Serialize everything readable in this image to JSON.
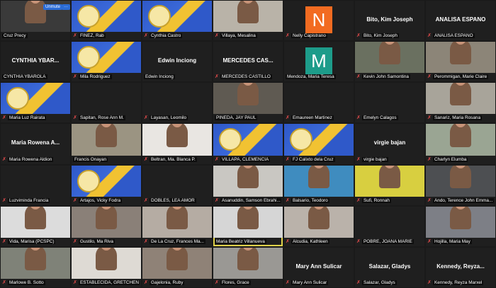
{
  "meeting": {
    "unmute_label": "Unmute",
    "more_label": "···"
  },
  "tiles": [
    {
      "name": "Cruz Precy",
      "type": "video",
      "muted": false,
      "bg": "#3a3a3a"
    },
    {
      "name": "FINEZ, Rab",
      "type": "logo",
      "muted": true
    },
    {
      "name": "Cynthia Castro",
      "type": "logo",
      "muted": true
    },
    {
      "name": "Villaya, Mesalina",
      "type": "video",
      "muted": true,
      "bg": "#b9b3a8"
    },
    {
      "name": "Nelly Capistrano",
      "type": "avatar",
      "letter": "N",
      "color": "#f26b21",
      "muted": true
    },
    {
      "name": "Bito, Kim Joseph",
      "type": "name",
      "title": "Bito, Kim Joseph",
      "muted": true
    },
    {
      "name": "ANALISA ESPANO",
      "type": "name",
      "title": "ANALISA ESPANO",
      "muted": true
    },
    {
      "name": "CYNTHIA YBAROLA",
      "type": "name",
      "title": "CYNTHIA YBAR...",
      "muted": false
    },
    {
      "name": "Mila Rodriguez",
      "type": "logo",
      "muted": true
    },
    {
      "name": "Edwin Inciong",
      "type": "name",
      "title": "Edwin Inciong",
      "muted": false
    },
    {
      "name": "MERCEDES CASTILLO",
      "type": "name",
      "title": "MERCEDES  CAS...",
      "muted": true
    },
    {
      "name": "Mendoza, Maria Teresa",
      "type": "avatar",
      "letter": "M",
      "color": "#1d9c8a",
      "muted": false
    },
    {
      "name": "Kevin John Samontina",
      "type": "video",
      "muted": true,
      "bg": "#6a7060"
    },
    {
      "name": "Perommigan, Marie Claire",
      "type": "video",
      "muted": true,
      "bg": "#8c8578"
    },
    {
      "name": "Maria Luz Rairata",
      "type": "logo",
      "muted": true
    },
    {
      "name": "Sapitan, Rose Ann M.",
      "type": "blank",
      "muted": true
    },
    {
      "name": "Layasan, Leomilo",
      "type": "blank",
      "muted": true
    },
    {
      "name": "PINEDA, JAY PAUL",
      "type": "video",
      "muted": false,
      "bg": "#5f5a52"
    },
    {
      "name": "Emaureen Martinez",
      "type": "blank",
      "muted": true
    },
    {
      "name": "Emelyn Calagos",
      "type": "blank",
      "muted": true
    },
    {
      "name": "Sanariz, Maria Rosana",
      "type": "video",
      "muted": true,
      "bg": "#a8a49a"
    },
    {
      "name": "Maria Rowena Aldion",
      "type": "name",
      "title": "Maria Rowena A...",
      "muted": true
    },
    {
      "name": "Francis Onayan",
      "type": "video",
      "muted": false,
      "bg": "#9b9482"
    },
    {
      "name": "Beltran, Ma. Blanca P.",
      "type": "video",
      "muted": true,
      "bg": "#e9e6e2"
    },
    {
      "name": "VILLAPA, CLEMENCIA",
      "type": "logo",
      "muted": true
    },
    {
      "name": "FJ Calixto dela Cruz",
      "type": "logo",
      "muted": true
    },
    {
      "name": "virgie bajan",
      "type": "name",
      "title": "virgie bajan",
      "muted": true
    },
    {
      "name": "Charlyn Elumba",
      "type": "video",
      "muted": true,
      "bg": "#9aa593"
    },
    {
      "name": "Luzviminda Francia",
      "type": "blank",
      "muted": true
    },
    {
      "name": "Artajos, Vicky Fodra",
      "type": "logo",
      "muted": true
    },
    {
      "name": "DOBLES, LEA AMOR",
      "type": "blank",
      "muted": true
    },
    {
      "name": "Asanuddin, Samson Ebrahi...",
      "type": "video",
      "muted": true,
      "bg": "#c9c7c2"
    },
    {
      "name": "Balsario, Teodoro",
      "type": "video",
      "muted": true,
      "bg": "#3f8cbf"
    },
    {
      "name": "Sufi, Ronnah",
      "type": "video",
      "muted": true,
      "bg": "#d8cf40"
    },
    {
      "name": "Ando, Terence John Emma...",
      "type": "video",
      "muted": true,
      "bg": "#4d4f52"
    },
    {
      "name": "Vida, Marisa (PCSPC)",
      "type": "video",
      "muted": true,
      "bg": "#dcdcdc"
    },
    {
      "name": "Gustilo, Ma Riva",
      "type": "video",
      "muted": true,
      "bg": "#8a8078"
    },
    {
      "name": "De La Cruz, Frances Ma...",
      "type": "video",
      "muted": true,
      "bg": "#b5aca3"
    },
    {
      "name": "Maria Beatriz Villanueva",
      "type": "video",
      "muted": false,
      "active": true,
      "bg": "#d6d6d6"
    },
    {
      "name": "Alcudia, Kathleen",
      "type": "video",
      "muted": true,
      "bg": "#bab2aa"
    },
    {
      "name": "POBRE, JOANA MARIE",
      "type": "blank",
      "muted": true
    },
    {
      "name": "Hojilla, Maria May",
      "type": "video",
      "muted": true,
      "bg": "#7d7f86"
    },
    {
      "name": "Marlowe B. Sotto",
      "type": "video",
      "muted": true,
      "bg": "#7f8278"
    },
    {
      "name": "ESTABLECIDA, GRETCHEN J...",
      "type": "video",
      "muted": true,
      "bg": "#dedad4"
    },
    {
      "name": "Gajelonia, Ruby",
      "type": "video",
      "muted": true,
      "bg": "#8f8277"
    },
    {
      "name": "Flores, Grace",
      "type": "video",
      "muted": true,
      "bg": "#9a9894"
    },
    {
      "name": "Mary Ann Sulicar",
      "type": "name",
      "title": "Mary Ann Sulicar",
      "muted": true
    },
    {
      "name": "Salazar, Gladys",
      "type": "name",
      "title": "Salazar, Gladys",
      "muted": true
    },
    {
      "name": "Kennedy, Reyza Marxel",
      "type": "name",
      "title": "Kennedy,  Reyza...",
      "muted": true
    }
  ]
}
